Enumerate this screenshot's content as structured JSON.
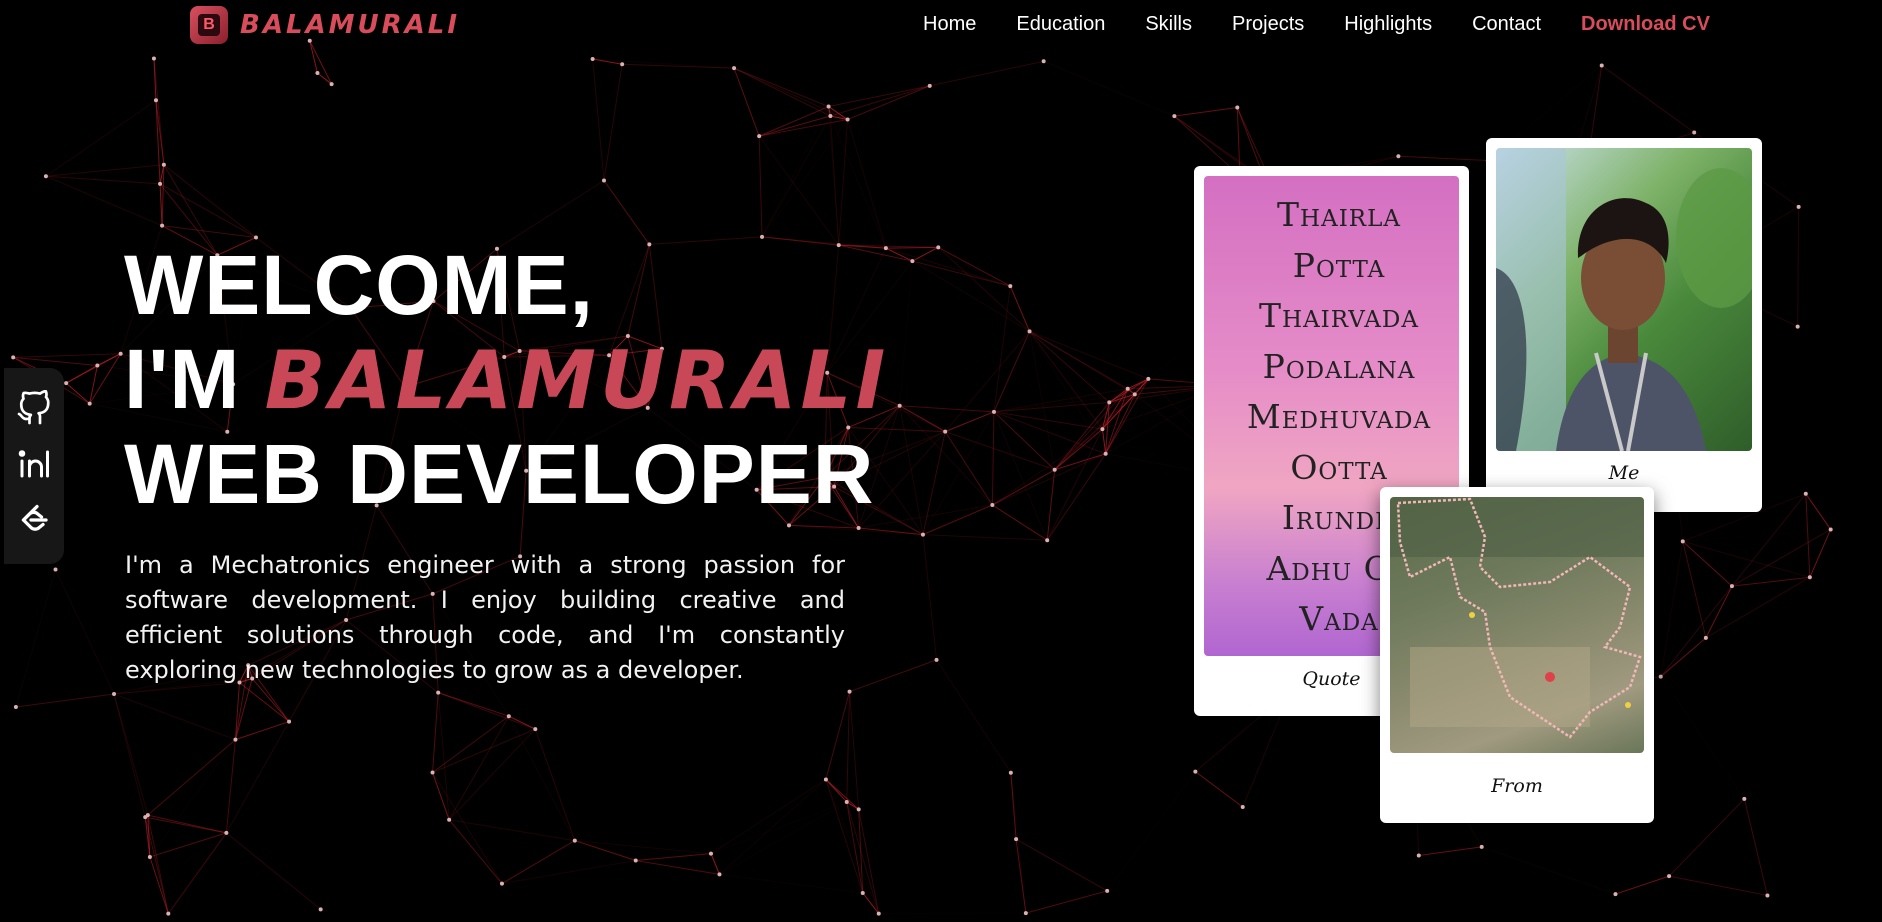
{
  "brand": {
    "icon_letter": "B",
    "name": "BALAMURALI"
  },
  "nav": {
    "items": [
      "Home",
      "Education",
      "Skills",
      "Projects",
      "Highlights",
      "Contact"
    ],
    "cta": "Download CV"
  },
  "social": {
    "icons": [
      "github-icon",
      "linkedin-icon",
      "leetcode-icon"
    ]
  },
  "hero": {
    "line1": "WELCOME,",
    "line2_prefix": "I'M",
    "line2_name": "BALAMURALI",
    "line3": "WEB DEVELOPER",
    "description": "I'm a Mechatronics engineer with a strong passion for software development. I enjoy building creative and efficient solutions through code, and I'm constantly exploring new technologies to grow as a developer."
  },
  "cards": {
    "quote": {
      "lines": [
        "Thairla",
        "Potta",
        "Thairvada",
        "Podalana",
        "Medhuvada",
        "Ootta",
        "Irundh",
        "Adhu Oo",
        "Vada"
      ],
      "caption": "Quote"
    },
    "me": {
      "caption": "Me"
    },
    "map": {
      "caption": "From"
    }
  },
  "colors": {
    "accent": "#d94c5b",
    "background": "#000000",
    "network_line": "#c8202a"
  }
}
